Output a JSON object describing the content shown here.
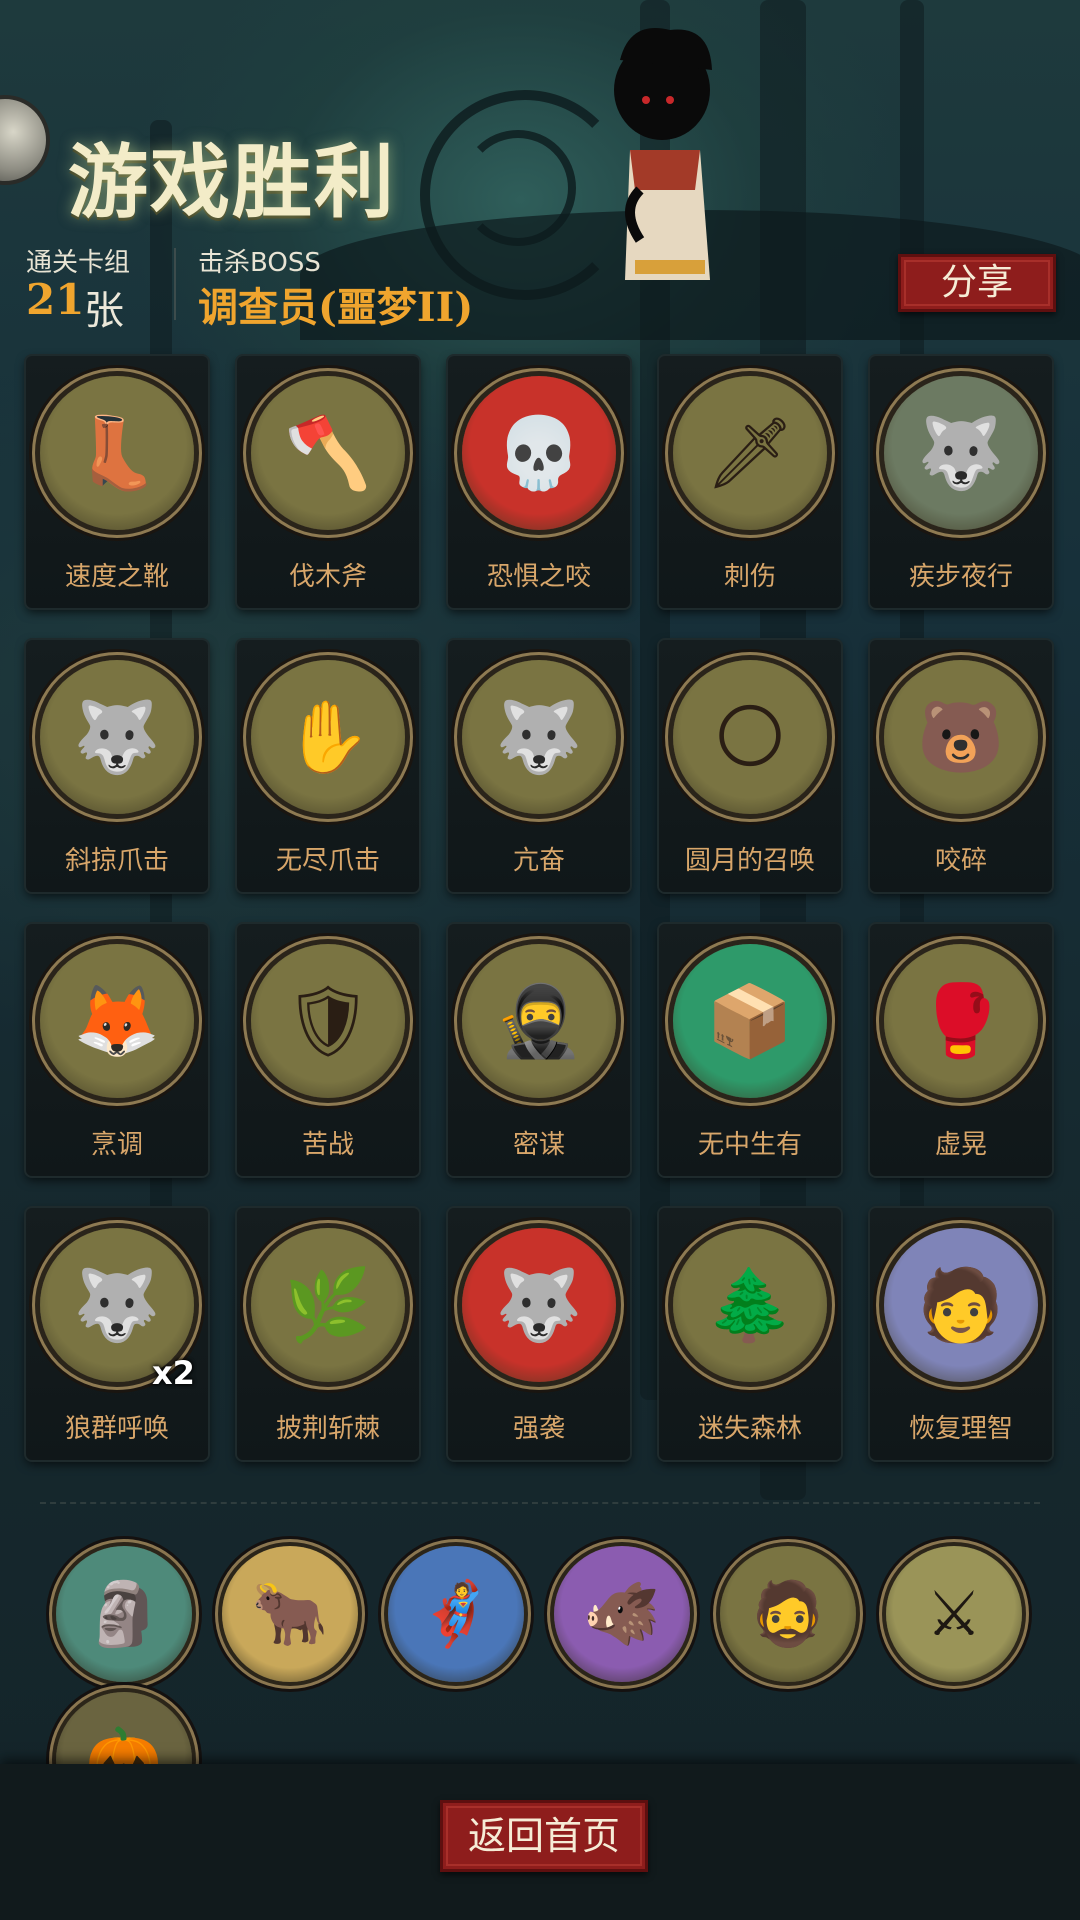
{
  "header": {
    "title": "游戏胜利",
    "deck_label": "通关卡组",
    "deck_count": "21",
    "deck_unit": "张",
    "boss_label": "击杀BOSS",
    "boss_name": "调查员(噩梦II)",
    "share_label": "分享"
  },
  "cards": [
    {
      "label": "速度之靴",
      "icon": "boot-icon",
      "glyph": "👢",
      "bg": "#7a7442"
    },
    {
      "label": "伐木斧",
      "icon": "axe-icon",
      "glyph": "🪓",
      "bg": "#7a7442"
    },
    {
      "label": "恐惧之咬",
      "icon": "fear-skull-icon",
      "glyph": "💀",
      "bg": "#c8322a"
    },
    {
      "label": "刺伤",
      "icon": "dagger-icon",
      "glyph": "🗡",
      "bg": "#7a7442"
    },
    {
      "label": "疾步夜行",
      "icon": "night-wolf-icon",
      "glyph": "🐺",
      "bg": "#6c7a62"
    },
    {
      "label": "斜掠爪击",
      "icon": "werewolf-claw-icon",
      "glyph": "🐺",
      "bg": "#7a7442"
    },
    {
      "label": "无尽爪击",
      "icon": "endless-claw-icon",
      "glyph": "✋",
      "bg": "#7a7442"
    },
    {
      "label": "亢奋",
      "icon": "frenzy-werewolf-icon",
      "glyph": "🐺",
      "bg": "#7a7442"
    },
    {
      "label": "圆月的召唤",
      "icon": "full-moon-icon",
      "glyph": "🌕",
      "bg": "#7a7442"
    },
    {
      "label": "咬碎",
      "icon": "crush-bite-icon",
      "glyph": "🐻",
      "bg": "#7a7442"
    },
    {
      "label": "烹调",
      "icon": "cooking-fox-icon",
      "glyph": "🦊",
      "bg": "#7a7442"
    },
    {
      "label": "苦战",
      "icon": "struggle-warrior-icon",
      "glyph": "🛡",
      "bg": "#7a7442"
    },
    {
      "label": "密谋",
      "icon": "hooded-plot-icon",
      "glyph": "🥷",
      "bg": "#7a7442"
    },
    {
      "label": "无中生有",
      "icon": "summon-box-icon",
      "glyph": "📦",
      "bg": "#2e9a6a"
    },
    {
      "label": "虚晃",
      "icon": "boxer-feint-icon",
      "glyph": "🥊",
      "bg": "#7a7442"
    },
    {
      "label": "狼群呼唤",
      "icon": "wolf-pack-icon",
      "glyph": "🐺",
      "bg": "#7a7442",
      "badge": "x2"
    },
    {
      "label": "披荆斩棘",
      "icon": "thorn-cleave-icon",
      "glyph": "🌿",
      "bg": "#7a7442"
    },
    {
      "label": "强袭",
      "icon": "assault-werewolf-icon",
      "glyph": "🐺",
      "bg": "#c8322a"
    },
    {
      "label": "迷失森林",
      "icon": "lost-forest-icon",
      "glyph": "🌲",
      "bg": "#7a7442"
    },
    {
      "label": "恢复理智",
      "icon": "restore-sanity-icon",
      "glyph": "🧑",
      "bg": "#7f84b8"
    }
  ],
  "relics": [
    {
      "icon": "cannon-relic-icon",
      "glyph": "🗿",
      "bg": "#4e8a7a"
    },
    {
      "icon": "horned-skull-relic-icon",
      "glyph": "🐂",
      "bg": "#c9a85a"
    },
    {
      "icon": "hero-cape-relic-icon",
      "glyph": "🦸",
      "bg": "#4a76b8"
    },
    {
      "icon": "beast-purple-relic-icon",
      "glyph": "🐗",
      "bg": "#8b5cb0"
    },
    {
      "icon": "pirate-face-relic-icon",
      "glyph": "🧔",
      "bg": "#7a7442"
    },
    {
      "icon": "claws-relic-icon",
      "glyph": "⚔",
      "bg": "#9a9458"
    },
    {
      "icon": "pumpkin-relic-icon",
      "glyph": "🎃",
      "bg": "#6a6440"
    }
  ],
  "footer": {
    "home_label": "返回首页"
  }
}
